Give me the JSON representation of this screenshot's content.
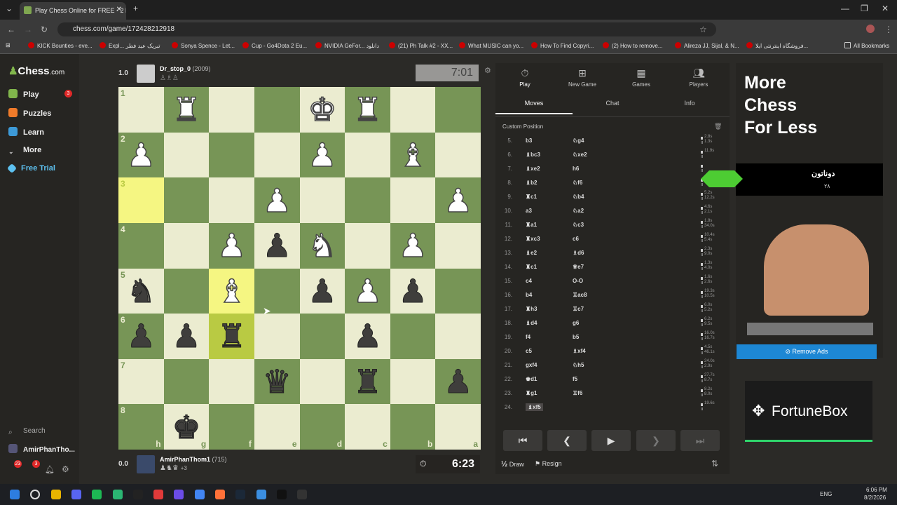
{
  "browser": {
    "tab_title": "Play Chess Online for FREE - 2 P",
    "url": "chess.com/game/172428212918",
    "bookmarks": [
      "KICK Bounties - eve...",
      "Expl... تبریک عید فطر",
      "Sonya Spence - Let...",
      "Cup - Go4Dota 2 Eu...",
      "NVIDIA GeFor... دانلود",
      "(21) Ph Talk #2 - XX...",
      "What MUSIC can yo...",
      "How To Find Copyri...",
      "(2) How to remove...",
      "Alireza JJ, Sijal, & N...",
      "فروشگاه اینترنتی ایلا...",
      "All Bookmarks"
    ]
  },
  "sidebar": {
    "logo": "Chess",
    "logo_suffix": ".com",
    "items": [
      {
        "label": "Play",
        "badge": "3"
      },
      {
        "label": "Puzzles"
      },
      {
        "label": "Learn"
      },
      {
        "label": "More"
      },
      {
        "label": "Free Trial"
      }
    ],
    "search": "Search",
    "user": "AmirPhanTho...",
    "badge_a": "23",
    "badge_b": "3"
  },
  "top_player": {
    "score": "1.0",
    "name": "Dr_stop_0",
    "rating": "(2009)",
    "clock": "7:01"
  },
  "bottom_player": {
    "score": "0.0",
    "name": "AmirPhanThom1",
    "rating": "(715)",
    "captured_extra": "+3",
    "clock": "6:23"
  },
  "board": {
    "ranks": [
      "1",
      "2",
      "3",
      "4",
      "5",
      "6",
      "7",
      "8"
    ],
    "files": [
      "h",
      "g",
      "f",
      "e",
      "d",
      "c",
      "b",
      "a"
    ],
    "rows": [
      [
        "",
        "wR",
        "",
        "",
        "wK",
        "wR",
        "",
        ""
      ],
      [
        "wP",
        "",
        "",
        "",
        "wP",
        "",
        "wB",
        ""
      ],
      [
        "",
        "",
        "",
        "wP",
        "",
        "",
        "",
        "wP"
      ],
      [
        "",
        "",
        "wP",
        "bP",
        "wN",
        "",
        "wP",
        ""
      ],
      [
        "bN",
        "",
        "wB",
        "",
        "bP",
        "wP",
        "bP",
        ""
      ],
      [
        "bP",
        "bP",
        "bR",
        "",
        "",
        "bP",
        "",
        ""
      ],
      [
        "",
        "",
        "",
        "bQ",
        "",
        "bR",
        "",
        "bP"
      ],
      [
        "",
        "bK",
        "",
        "",
        "",
        "",
        "",
        ""
      ]
    ],
    "highlights": [
      [
        2,
        0
      ],
      [
        4,
        2
      ],
      [
        5,
        2
      ]
    ]
  },
  "panel": {
    "tabs": [
      "Play",
      "New Game",
      "Games",
      "Players"
    ],
    "subtabs": [
      "Moves",
      "Chat",
      "Info"
    ],
    "custom_position": "Custom Position",
    "moves": [
      {
        "n": "5.",
        "w": "b3",
        "b": "♘g4",
        "t": [
          "2.8s",
          "1.3s"
        ]
      },
      {
        "n": "6.",
        "w": "♝bc3",
        "b": "♘xe2",
        "t": [
          "11.9s",
          ""
        ]
      },
      {
        "n": "7.",
        "w": "♝xe2",
        "b": "h6",
        "t": [
          "",
          ""
        ]
      },
      {
        "n": "8.",
        "w": "♝b2",
        "b": "♘f6",
        "t": [
          "",
          ""
        ]
      },
      {
        "n": "9.",
        "w": "♜c1",
        "b": "♘b4",
        "t": [
          "5.2s",
          "12.2s"
        ]
      },
      {
        "n": "10.",
        "w": "a3",
        "b": "♘a2",
        "t": [
          "4.6s",
          "2.1s"
        ]
      },
      {
        "n": "11.",
        "w": "♜a1",
        "b": "♘c3",
        "t": [
          "1.8s",
          "34.0s"
        ]
      },
      {
        "n": "12.",
        "w": "♜xc3",
        "b": "c6",
        "t": [
          "10.4s",
          "5.4s"
        ]
      },
      {
        "n": "13.",
        "w": "♝e2",
        "b": "♗d6",
        "t": [
          "2.3s",
          "9.0s"
        ]
      },
      {
        "n": "14.",
        "w": "♜c1",
        "b": "♕e7",
        "t": [
          "1.3s",
          "4.0s"
        ]
      },
      {
        "n": "15.",
        "w": "c4",
        "b": "O-O",
        "t": [
          "1.6s",
          "2.6s"
        ]
      },
      {
        "n": "16.",
        "w": "b4",
        "b": "♖ac8",
        "t": [
          "19.3s",
          "10.5s"
        ]
      },
      {
        "n": "17.",
        "w": "♜h3",
        "b": "♖c7",
        "t": [
          "6.0s",
          "5.2s"
        ]
      },
      {
        "n": "18.",
        "w": "♝d4",
        "b": "g6",
        "t": [
          "6.2s",
          "9.5s"
        ]
      },
      {
        "n": "19.",
        "w": "f4",
        "b": "b5",
        "t": [
          "16.0s",
          "16.7s"
        ]
      },
      {
        "n": "20.",
        "w": "c5",
        "b": "♗xf4",
        "t": [
          "4.5s",
          "46.1s"
        ]
      },
      {
        "n": "21.",
        "w": "gxf4",
        "b": "♘h5",
        "t": [
          "24.0s",
          "2.9s"
        ]
      },
      {
        "n": "22.",
        "w": "♚d1",
        "b": "f5",
        "t": [
          "27.7s",
          "8.7s"
        ]
      },
      {
        "n": "23.",
        "w": "♜g1",
        "b": "♖f6",
        "t": [
          "8.2s",
          "8.0s"
        ]
      },
      {
        "n": "24.",
        "w": "♝xf5",
        "b": "",
        "t": [
          "19.6s",
          ""
        ]
      }
    ],
    "controls": [
      "⏮",
      "❮",
      "▶",
      "❯",
      "⏭"
    ],
    "draw": "Draw",
    "resign": "Resign"
  },
  "ads": {
    "headline": [
      "More",
      "Chess",
      "For Less"
    ],
    "persian": "دوناتون",
    "persian_sub": "۲۸",
    "remove": "Remove Ads",
    "fortune": "FortuneBox"
  },
  "taskbar": {
    "lang": "ENG",
    "time": "6:06 PM",
    "date": "8/2/2026"
  },
  "colors": {
    "light_square": "#ebecd0",
    "dark_square": "#779556",
    "highlight": "#f5f682",
    "accent": "#81b64c",
    "remove_btn": "#1d87d4"
  }
}
